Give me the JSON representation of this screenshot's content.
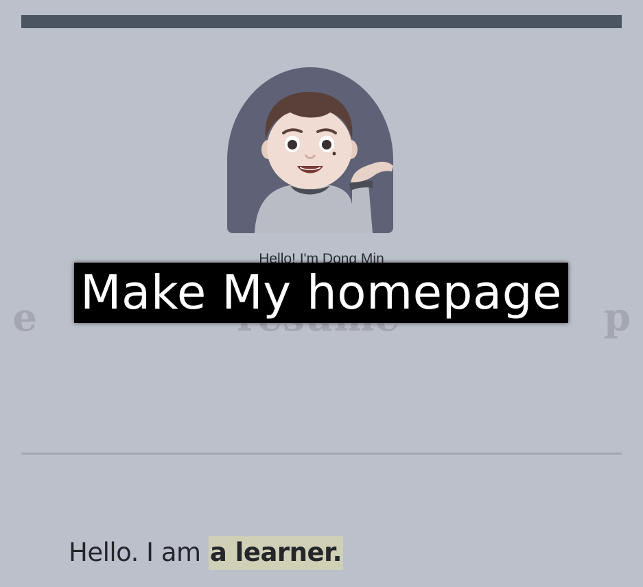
{
  "profile": {
    "greeting": "Hello! I'm Dong Min"
  },
  "carousel": {
    "left_partial": "e",
    "center": "resume",
    "right_partial": "p"
  },
  "caption": {
    "text": "Make My homepage"
  },
  "intro": {
    "prefix": "Hello. I am ",
    "highlight": "a learner."
  },
  "colors": {
    "page_background": "#bcc0ca",
    "top_bar": "#4b5562",
    "avatar_background": "#5f6276",
    "divider": "#a3a7b1",
    "highlight": "#cfd0b6"
  }
}
